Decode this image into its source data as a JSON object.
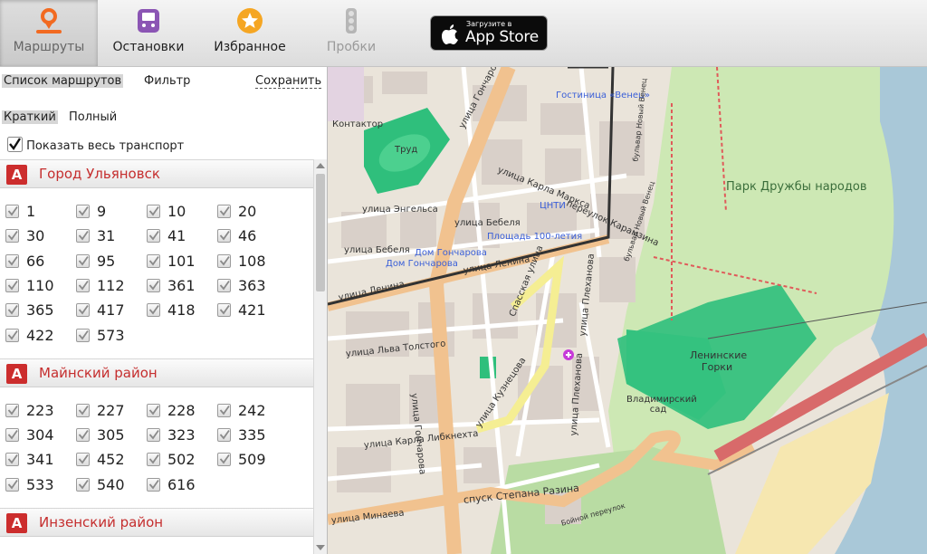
{
  "nav": {
    "tabs": [
      {
        "label": "Маршруты",
        "icon": "route-pin-icon",
        "state": "active"
      },
      {
        "label": "Остановки",
        "icon": "bus-stop-icon",
        "state": "normal"
      },
      {
        "label": "Избранное",
        "icon": "star-icon",
        "state": "normal"
      },
      {
        "label": "Пробки",
        "icon": "traffic-light-icon",
        "state": "disabled"
      }
    ],
    "appstore": {
      "small": "Загрузите в",
      "big": "App Store"
    }
  },
  "panel": {
    "tab_list": "Список маршрутов",
    "tab_filter": "Фильтр",
    "save": "Сохранить",
    "view_short": "Краткий",
    "view_full": "Полный",
    "show_all": "Показать весь транспорт"
  },
  "sections": [
    {
      "badge": "А",
      "name": "Город Ульяновск",
      "routes": [
        "1",
        "9",
        "10",
        "20",
        "30",
        "31",
        "41",
        "46",
        "66",
        "95",
        "101",
        "108",
        "110",
        "112",
        "361",
        "363",
        "365",
        "417",
        "418",
        "421",
        "422",
        "573"
      ]
    },
    {
      "badge": "А",
      "name": "Майнский район",
      "routes": [
        "223",
        "227",
        "228",
        "242",
        "304",
        "305",
        "323",
        "335",
        "341",
        "452",
        "502",
        "509",
        "533",
        "540",
        "616"
      ]
    },
    {
      "badge": "А",
      "name": "Инзенский район",
      "routes": []
    }
  ],
  "map": {
    "labels": {
      "goncharova_n": "улица Гончарова",
      "goncharova_s": "улица Гончарова",
      "hotel": "Гостиница «Венец»",
      "kontaktor": "Контактор",
      "trud": "Труд",
      "karla_marksa": "улица Карла Маркса",
      "engelsa": "улица Энгельса",
      "bebelya": "улица Бебеля",
      "bebelya2": "улица Бебеля",
      "tsnti": "ЦНТИ",
      "karamzina": "переулок Карамзина",
      "ploshchad": "Площадь 100-летия",
      "dom_goncharova": "Дом Гончарова",
      "dom_goncharova2": "Дом Гончарова",
      "lenina": "улица Ленина",
      "lenina2": "улица Ленина",
      "spasskaya": "Спасская улица",
      "park": "Парк Дружбы народов",
      "leninskie_gorki": "Ленинские Горки",
      "lva_tolstogo": "улица Льва Толстого",
      "plekhanova": "улица Плеханова",
      "plekhanova2": "улица Плеханова",
      "kuznetsova": "улица Кузнецова",
      "karla_libknekhta": "улица Карла Либкнехта",
      "vladimirsky": "Владимирский сад",
      "stepana_razina": "спуск Степана Разина",
      "minaeva": "улица Минаева",
      "bulvar_venec": "бульвар Новый Венец",
      "bulvar_venec2": "бульвар Новый Венец",
      "bolnoy": "Бойной переулок"
    }
  },
  "colors": {
    "accent_red": "#cc2d2d",
    "main_road": "#f1c28f",
    "park_green": "#c8e6b0",
    "water": "#aac9d8",
    "tram": "#333333"
  }
}
